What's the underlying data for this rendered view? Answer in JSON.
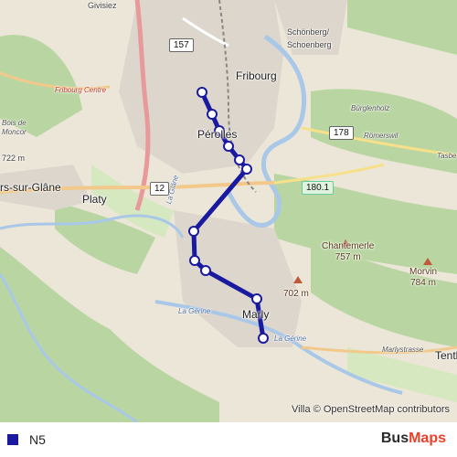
{
  "map": {
    "places": {
      "givisiez": "Givisiez",
      "fribourg": "Fribourg",
      "schoenberg_1": "Schönberg/",
      "schoenberg_2": "Schoenberg",
      "fribourg_centre": "Fribourg Centre",
      "bois_de_moncor_1": "Bois de",
      "bois_de_moncor_2": "Moncor",
      "perolles": "Pérolles",
      "burglenholz": "Bürglenholz",
      "romerswil": "Römerswil",
      "tasberg": "Tasbe",
      "villars": "rs-sur-Glâne",
      "platy": "Platy",
      "chantemerle": "Chantemerle",
      "chantemerle_alt": "757 m",
      "morvin": "Morvin",
      "morvin_alt": "784 m",
      "alt_702": "702 m",
      "alt_722": "722 m",
      "marly": "Marly",
      "marlystrasse": "Marlystrasse",
      "tentl": "Tentl",
      "villars_vert": "Villa",
      "la_gerine": "La Gérine",
      "la_gerine_2": "La Gérine",
      "la_glane": "La Glâne"
    },
    "shields": {
      "r157": "157",
      "r178": "178",
      "r12": "12",
      "r1801": "180.1"
    },
    "attribution": "© OpenStreetMap contributors",
    "route_color": "#1a1aa0",
    "stop_count_note": ""
  },
  "footer": {
    "route_name": "N5",
    "route_color": "#1a1aa0",
    "brand_bus": "Bus",
    "brand_maps": "Maps"
  }
}
